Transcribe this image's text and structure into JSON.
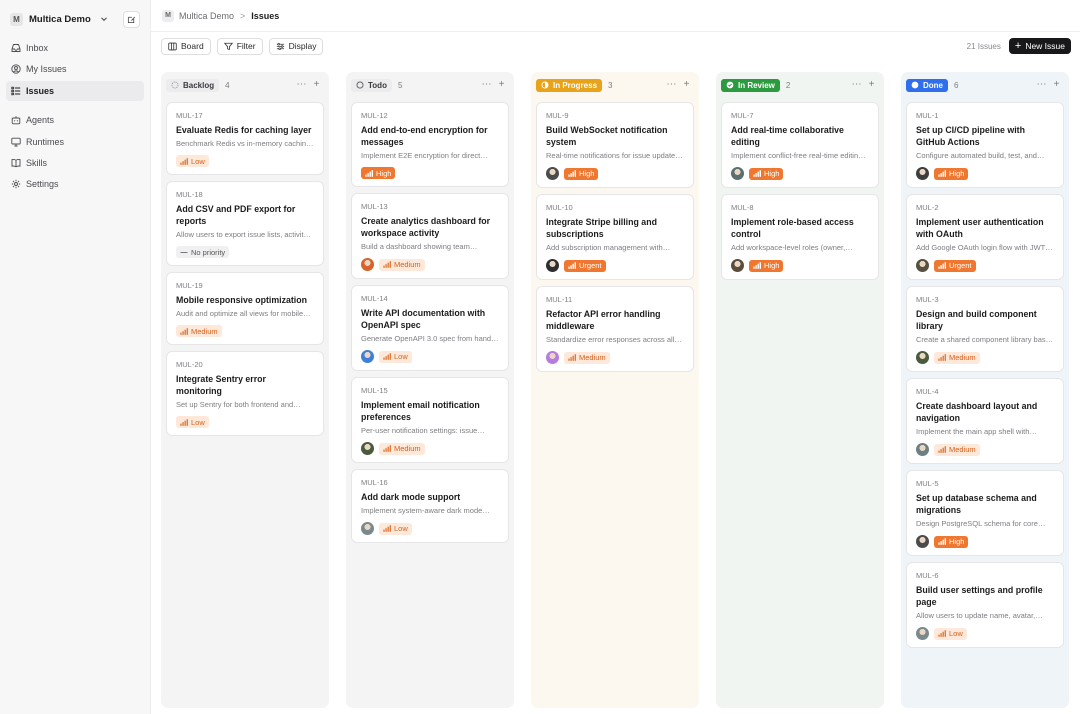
{
  "workspace": {
    "logo": "M",
    "name": "Multica Demo"
  },
  "nav": [
    {
      "label": "Inbox",
      "icon": "inbox-icon"
    },
    {
      "label": "My Issues",
      "icon": "user-circle-icon"
    },
    {
      "label": "Issues",
      "icon": "list-icon",
      "active": true
    },
    {
      "label": "Agents",
      "icon": "bot-icon"
    },
    {
      "label": "Runtimes",
      "icon": "monitor-icon"
    },
    {
      "label": "Skills",
      "icon": "book-icon"
    },
    {
      "label": "Settings",
      "icon": "gear-icon"
    }
  ],
  "breadcrumb": {
    "logo": "M",
    "workspace": "Multica Demo",
    "separator": ">",
    "current": "Issues"
  },
  "toolbar": {
    "board": "Board",
    "filter": "Filter",
    "display": "Display",
    "count": "21 Issues",
    "new_issue": "New Issue"
  },
  "colors": {
    "priority_strong": "#f0772f",
    "priority_soft_bg": "#fde8d9",
    "in_progress": "#e8a31a",
    "in_review": "#2c9a3f",
    "done": "#2f6fec"
  },
  "columns": [
    {
      "name": "Backlog",
      "count": "4",
      "bg": "#f4f4f5",
      "pill_bg": "#ececee",
      "pill_color": "#3a3a3f",
      "dot": "ring-grey",
      "cards": [
        {
          "id": "MUL-17",
          "title": "Evaluate Redis for caching layer",
          "desc": "Benchmark Redis vs in-memory caching…",
          "priority": "Low",
          "level": "soft",
          "avatar": ""
        },
        {
          "id": "MUL-18",
          "title": "Add CSV and PDF export for reports",
          "desc": "Allow users to export issue lists, activity…",
          "priority": "No priority",
          "level": "none",
          "avatar": ""
        },
        {
          "id": "MUL-19",
          "title": "Mobile responsive optimization",
          "desc": "Audit and optimize all views for mobile…",
          "priority": "Medium",
          "level": "soft",
          "avatar": ""
        },
        {
          "id": "MUL-20",
          "title": "Integrate Sentry error monitoring",
          "desc": "Set up Sentry for both frontend and…",
          "priority": "Low",
          "level": "soft",
          "avatar": ""
        }
      ]
    },
    {
      "name": "Todo",
      "count": "5",
      "bg": "#f4f4f5",
      "pill_bg": "#ececee",
      "pill_color": "#3a3a3f",
      "dot": "ring-dark",
      "cards": [
        {
          "id": "MUL-12",
          "title": "Add end-to-end encryption for messages",
          "desc": "Implement E2E encryption for direct…",
          "priority": "High",
          "level": "strong",
          "avatar": ""
        },
        {
          "id": "MUL-13",
          "title": "Create analytics dashboard for workspace activity",
          "desc": "Build a dashboard showing team…",
          "priority": "Medium",
          "level": "soft",
          "avatar": "#d9622a"
        },
        {
          "id": "MUL-14",
          "title": "Write API documentation with OpenAPI spec",
          "desc": "Generate OpenAPI 3.0 spec from handl…",
          "priority": "Low",
          "level": "soft",
          "avatar": "#3f7fd9"
        },
        {
          "id": "MUL-15",
          "title": "Implement email notification preferences",
          "desc": "Per-user notification settings: issue…",
          "priority": "Medium",
          "level": "soft",
          "avatar": "#4a5a3c"
        },
        {
          "id": "MUL-16",
          "title": "Add dark mode support",
          "desc": "Implement system-aware dark mode…",
          "priority": "Low",
          "level": "soft",
          "avatar": "#7a8a8c"
        }
      ]
    },
    {
      "name": "In Progress",
      "count": "3",
      "bg": "#fcf8ef",
      "pill_bg": "#e8a31a",
      "pill_color": "#ffffff",
      "dot": "half-white",
      "cards": [
        {
          "id": "MUL-9",
          "title": "Build WebSocket notification system",
          "desc": "Real-time notifications for issue update…",
          "priority": "High",
          "level": "strong",
          "avatar": "#4b4b4b"
        },
        {
          "id": "MUL-10",
          "title": "Integrate Stripe billing and subscriptions",
          "desc": "Add subscription management with…",
          "priority": "Urgent",
          "level": "strong",
          "avatar": "#2e2e2e"
        },
        {
          "id": "MUL-11",
          "title": "Refactor API error handling middleware",
          "desc": "Standardize error responses across all…",
          "priority": "Medium",
          "level": "soft",
          "avatar": "#b57be0"
        }
      ]
    },
    {
      "name": "In Review",
      "count": "2",
      "bg": "#f0f5f1",
      "pill_bg": "#2c9a3f",
      "pill_color": "#ffffff",
      "dot": "check-white",
      "cards": [
        {
          "id": "MUL-7",
          "title": "Add real-time collaborative editing",
          "desc": "Implement conflict-free real-time editin…",
          "priority": "High",
          "level": "strong",
          "avatar": "#5b6e70"
        },
        {
          "id": "MUL-8",
          "title": "Implement role-based access control",
          "desc": "Add workspace-level roles (owner,…",
          "priority": "High",
          "level": "strong",
          "avatar": "#5a4d3e"
        }
      ]
    },
    {
      "name": "Done",
      "count": "6",
      "bg": "#eff4f9",
      "pill_bg": "#2f6fec",
      "pill_color": "#ffffff",
      "dot": "full-white",
      "cards": [
        {
          "id": "MUL-1",
          "title": "Set up CI/CD pipeline with GitHub Actions",
          "desc": "Configure automated build, test, and…",
          "priority": "High",
          "level": "strong",
          "avatar": "#3d3d3d"
        },
        {
          "id": "MUL-2",
          "title": "Implement user authentication with OAuth",
          "desc": "Add Google OAuth login flow with JWT…",
          "priority": "Urgent",
          "level": "strong",
          "avatar": "#55503f"
        },
        {
          "id": "MUL-3",
          "title": "Design and build component library",
          "desc": "Create a shared component library base…",
          "priority": "Medium",
          "level": "soft",
          "avatar": "#4a5a3c"
        },
        {
          "id": "MUL-4",
          "title": "Create dashboard layout and navigation",
          "desc": "Implement the main app shell with…",
          "priority": "Medium",
          "level": "soft",
          "avatar": "#6c7f82"
        },
        {
          "id": "MUL-5",
          "title": "Set up database schema and migrations",
          "desc": "Design PostgreSQL schema for core…",
          "priority": "High",
          "level": "strong",
          "avatar": "#4b4b4b"
        },
        {
          "id": "MUL-6",
          "title": "Build user settings and profile page",
          "desc": "Allow users to update name, avatar,…",
          "priority": "Low",
          "level": "soft",
          "avatar": "#7a8a8c"
        }
      ]
    }
  ]
}
